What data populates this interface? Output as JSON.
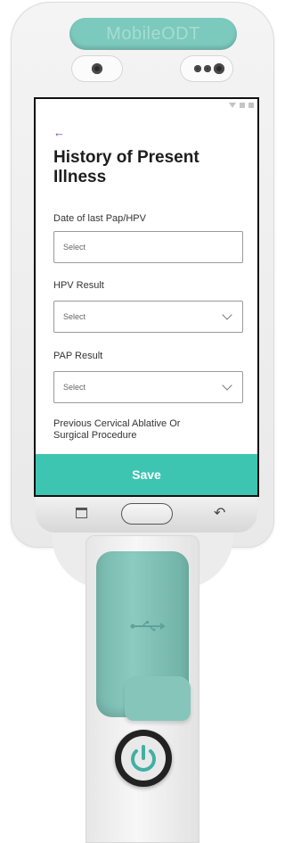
{
  "device": {
    "brand": "MobileODT",
    "colors": {
      "accent": "#3dc5b2",
      "teal_hardware": "#7cc9bd",
      "body": "#ececec"
    }
  },
  "screen": {
    "back_icon": "arrow-left-icon",
    "title": "History of Present Illness",
    "fields": [
      {
        "label": "Date of last Pap/HPV",
        "value": "Select",
        "type": "input"
      },
      {
        "label": "HPV Result",
        "value": "Select",
        "type": "dropdown"
      },
      {
        "label": "PAP Result",
        "value": "Select",
        "type": "dropdown"
      },
      {
        "label": "Previous Cervical Ablative Or Surgical Procedure"
      }
    ],
    "save_label": "Save"
  },
  "navbar": {
    "icons": [
      "recent-apps-icon",
      "home-button-icon",
      "back-icon"
    ]
  }
}
